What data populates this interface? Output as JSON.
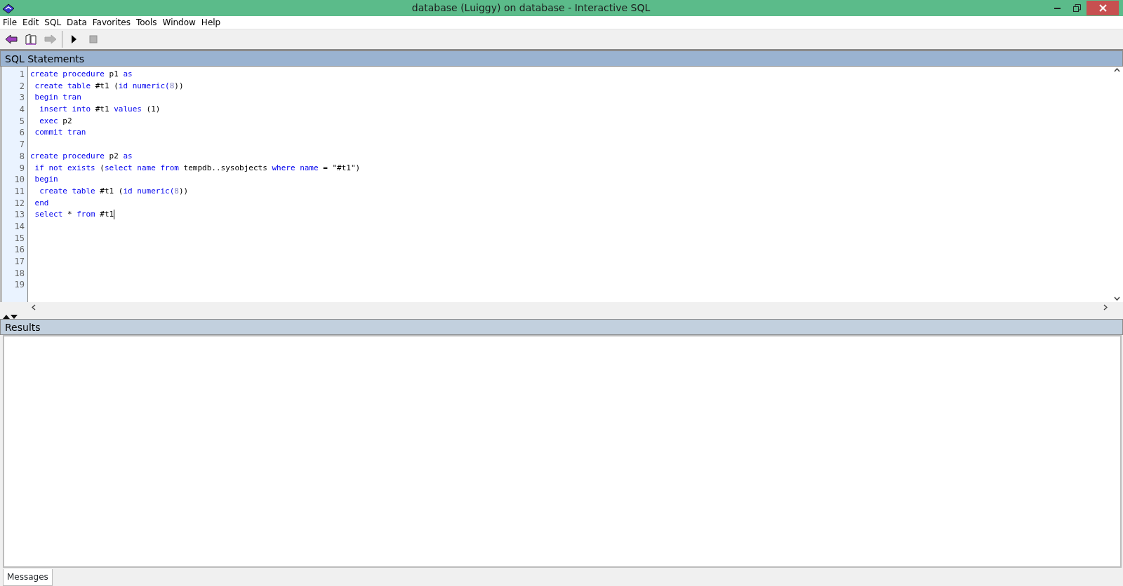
{
  "window": {
    "title": "database (Luiggy) on database - Interactive SQL"
  },
  "menu": [
    "File",
    "Edit",
    "SQL",
    "Data",
    "Favorites",
    "Tools",
    "Window",
    "Help"
  ],
  "toolbar": [
    {
      "kind": "back",
      "disabled": false
    },
    {
      "kind": "book",
      "disabled": false
    },
    {
      "kind": "forward",
      "disabled": true
    },
    {
      "kind": "separator"
    },
    {
      "kind": "run",
      "disabled": false
    },
    {
      "kind": "stop",
      "disabled": true
    }
  ],
  "sql_panel": {
    "title": "SQL Statements",
    "lines": [
      {
        "number": "1",
        "cursor": false,
        "segments": [
          {
            "text": "create procedure",
            "kind": "keyword"
          },
          {
            "text": " p1 ",
            "kind": "plain"
          },
          {
            "text": "as",
            "kind": "keyword"
          }
        ]
      },
      {
        "number": "2",
        "cursor": false,
        "segments": [
          {
            "text": " create table",
            "kind": "keyword"
          },
          {
            "text": " #t1 (",
            "kind": "plain"
          },
          {
            "text": "id numeric(",
            "kind": "keyword"
          },
          {
            "text": "8",
            "kind": "number"
          },
          {
            "text": "))",
            "kind": "plain"
          }
        ]
      },
      {
        "number": "3",
        "cursor": false,
        "segments": [
          {
            "text": " begin tran",
            "kind": "keyword"
          }
        ]
      },
      {
        "number": "4",
        "cursor": false,
        "segments": [
          {
            "text": "  insert into",
            "kind": "keyword"
          },
          {
            "text": " #t1 ",
            "kind": "plain"
          },
          {
            "text": "values",
            "kind": "keyword"
          },
          {
            "text": " (1)",
            "kind": "plain"
          }
        ]
      },
      {
        "number": "5",
        "cursor": false,
        "segments": [
          {
            "text": "  exec",
            "kind": "keyword"
          },
          {
            "text": " p2",
            "kind": "plain"
          }
        ]
      },
      {
        "number": "6",
        "cursor": false,
        "segments": [
          {
            "text": " commit tran",
            "kind": "keyword"
          }
        ]
      },
      {
        "number": "7",
        "cursor": false
      },
      {
        "number": "8",
        "cursor": false,
        "segments": [
          {
            "text": "create procedure",
            "kind": "keyword"
          },
          {
            "text": " p2 ",
            "kind": "plain"
          },
          {
            "text": "as",
            "kind": "keyword"
          }
        ]
      },
      {
        "number": "9",
        "cursor": false,
        "segments": [
          {
            "text": " if not exists",
            "kind": "keyword"
          },
          {
            "text": " (",
            "kind": "plain"
          },
          {
            "text": "select name from",
            "kind": "keyword"
          },
          {
            "text": " tempdb..sysobjects ",
            "kind": "plain"
          },
          {
            "text": "where name",
            "kind": "keyword"
          },
          {
            "text": " = \"#t1\")",
            "kind": "plain"
          }
        ]
      },
      {
        "number": "10",
        "cursor": false,
        "segments": [
          {
            "text": " begin",
            "kind": "keyword"
          }
        ]
      },
      {
        "number": "11",
        "cursor": false,
        "segments": [
          {
            "text": "  create table",
            "kind": "keyword"
          },
          {
            "text": " #t1 (",
            "kind": "plain"
          },
          {
            "text": "id numeric(",
            "kind": "keyword"
          },
          {
            "text": "8",
            "kind": "number"
          },
          {
            "text": "))",
            "kind": "plain"
          }
        ]
      },
      {
        "number": "12",
        "cursor": false,
        "segments": [
          {
            "text": " end",
            "kind": "keyword"
          }
        ]
      },
      {
        "number": "13",
        "cursor": true,
        "segments": [
          {
            "text": " select",
            "kind": "keyword"
          },
          {
            "text": " * ",
            "kind": "plain"
          },
          {
            "text": "from",
            "kind": "keyword"
          },
          {
            "text": " #t1",
            "kind": "plain"
          }
        ]
      },
      {
        "number": "14",
        "cursor": false
      },
      {
        "number": "15",
        "cursor": false
      },
      {
        "number": "16",
        "cursor": false
      },
      {
        "number": "17",
        "cursor": false
      },
      {
        "number": "18",
        "cursor": false
      },
      {
        "number": "19",
        "cursor": false
      }
    ]
  },
  "results_panel": {
    "title": "Results"
  },
  "bottom_tabs": [
    {
      "label": "Messages",
      "selected": true
    }
  ]
}
